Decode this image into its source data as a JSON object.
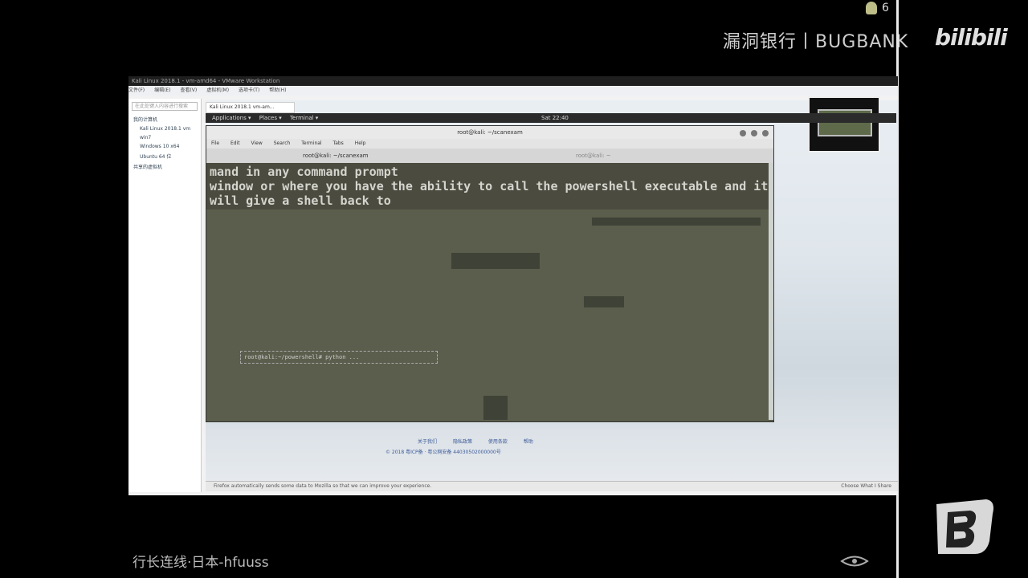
{
  "watermark": {
    "brand_text": "漏洞银行丨BUGBANK",
    "bili_logo": "bilibili",
    "notification_count": "6"
  },
  "vmware": {
    "title": "Kali Linux 2018.1 - vm-amd64 - VMware Workstation",
    "menu": [
      "文件(F)",
      "编辑(E)",
      "查看(V)",
      "虚拟机(M)",
      "选项卡(T)",
      "帮助(H)"
    ],
    "library": {
      "search_placeholder": "在此处键入内容进行搜索",
      "items": [
        "我的计算机",
        "Kali Linux 2018.1 vm",
        "win7",
        "Windows 10 x64",
        "Ubuntu 64 位",
        "共享的虚拟机"
      ]
    },
    "tab_label": "Kali Linux 2018.1 vm-am...",
    "status_text": "Firefox automatically sends some data to Mozilla so that we can improve your experience.",
    "status_right": "Choose What I Share"
  },
  "gnome": {
    "applications": "Applications ▾",
    "places": "Places ▾",
    "terminal": "Terminal ▾",
    "clock": "Sat 22:40"
  },
  "terminal": {
    "title": "root@kali: ~/scanexam",
    "menu": [
      "File",
      "Edit",
      "View",
      "Search",
      "Terminal",
      "Tabs",
      "Help"
    ],
    "tab1": "root@kali: ~/scanexam",
    "tab2": "root@kali: ~",
    "subtitle_lines": [
      "mand in any command prompt",
      "window or where you have the ability to call the powershell executable and it",
      " will give a shell back to"
    ],
    "prompt_text": "root@kali:~/powershell# python ..."
  },
  "links": {
    "row1": [
      "关于我们",
      "隐私政策",
      "使用条款",
      "帮助"
    ],
    "row2": "© 2018 粤ICP备 · 粤公网安备 44030502000000号"
  },
  "caption": {
    "text": "行长连线·日本-hfuuss"
  }
}
